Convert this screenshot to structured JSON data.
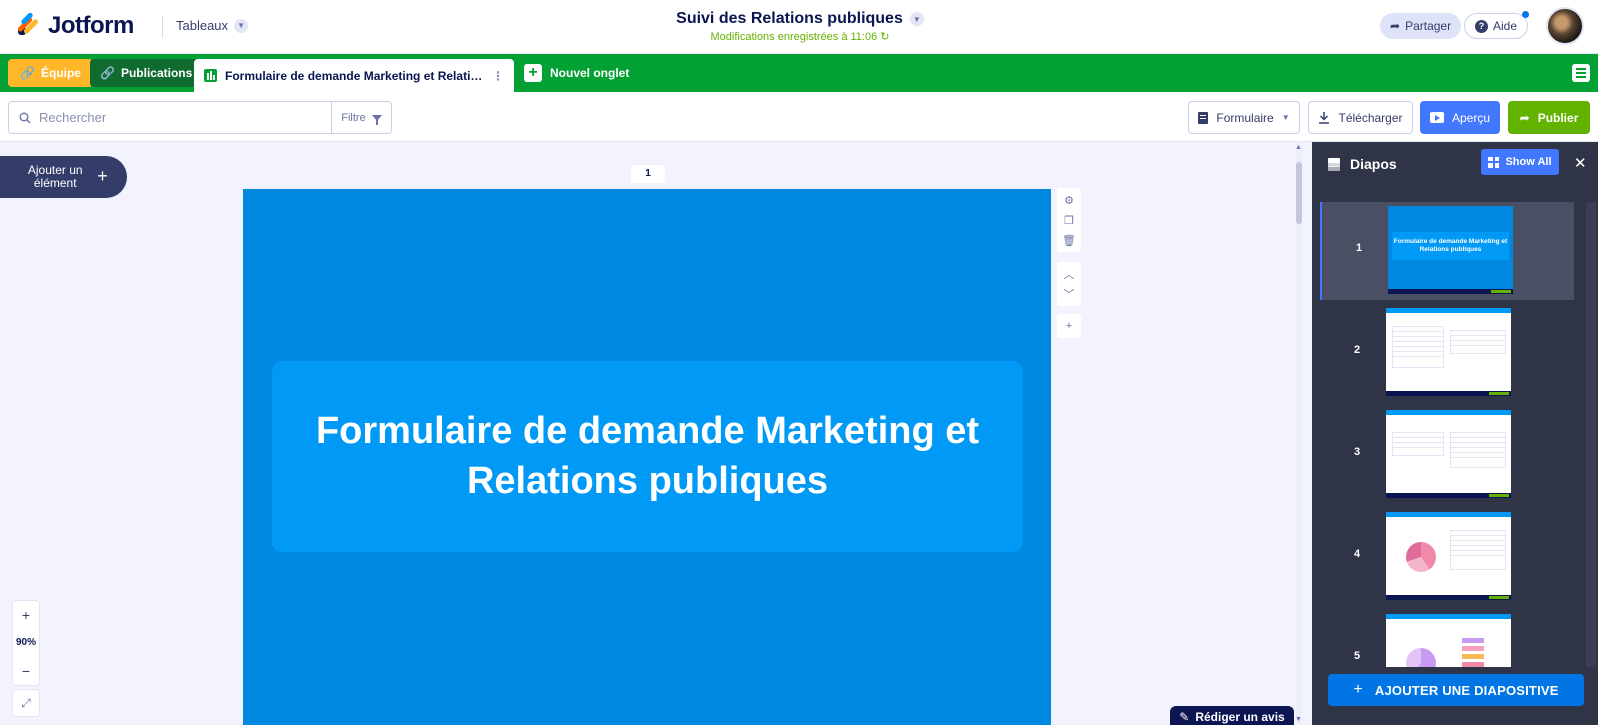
{
  "header": {
    "brand": "Jotform",
    "workspace": "Tableaux",
    "doc_title": "Suivi des Relations publiques",
    "saved_status": "Modifications enregistrées à 11:06",
    "share_label": "Partager",
    "help_label": "Aide"
  },
  "tabs": {
    "equipe": "Équipe",
    "publications": "Publications",
    "active_form": "Formulaire de demande Marketing et Relations publiques",
    "new_tab": "Nouvel onglet"
  },
  "toolbar": {
    "search_placeholder": "Rechercher",
    "filter_label": "Filtre",
    "formulaire_label": "Formulaire",
    "download_label": "Télécharger",
    "preview_label": "Aperçu",
    "publish_label": "Publier"
  },
  "canvas": {
    "add_element": "Ajouter un élément",
    "page_number": "1",
    "slide_title": "Formulaire de demande Marketing et Relations publiques",
    "zoom": "90%",
    "review_label": "Rédiger un avis"
  },
  "panel": {
    "title": "Diapos",
    "show_all": "Show All",
    "add_slide": "AJOUTER UNE DIAPOSITIVE",
    "slides": [
      {
        "num": "1",
        "thumb_title": "Formulaire de demande Marketing et Relations publiques"
      },
      {
        "num": "2"
      },
      {
        "num": "3"
      },
      {
        "num": "4"
      },
      {
        "num": "5"
      }
    ]
  },
  "colors": {
    "tab_bar": "#03a033",
    "equipe": "#ffb629",
    "preview": "#4277ff",
    "publish": "#64b200",
    "slide_bg": "#0088e0",
    "panel_bg": "#2f3447",
    "add_slide": "#0075e3"
  },
  "icons": [
    "search-icon",
    "filter-icon",
    "link-icon",
    "sheet-icon",
    "plus-icon",
    "menu-icon",
    "document-icon",
    "download-icon",
    "play-icon",
    "share-arrow-icon",
    "help-icon",
    "gear-icon",
    "copy-icon",
    "trash-icon",
    "chevron-up-icon",
    "chevron-down-icon",
    "layers-icon",
    "grid-icon",
    "close-icon",
    "expand-icon",
    "edit-icon"
  ]
}
